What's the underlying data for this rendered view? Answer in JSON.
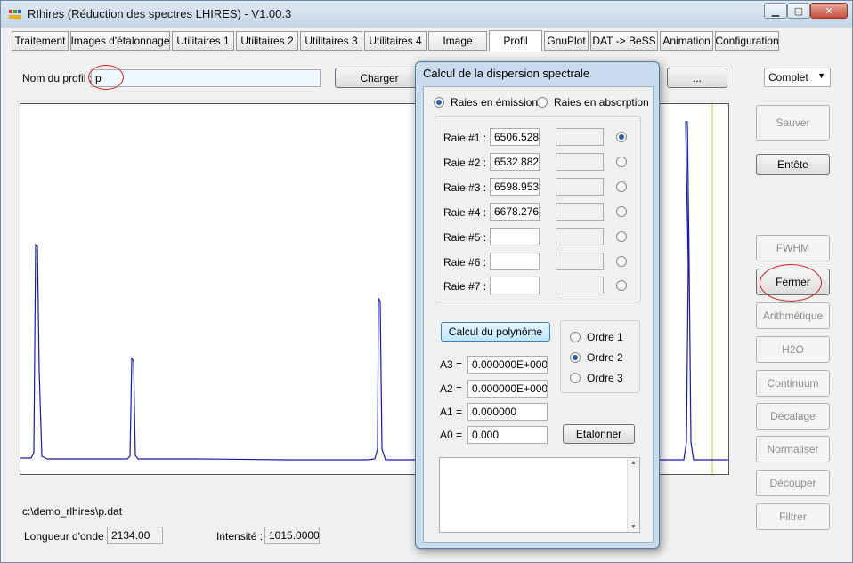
{
  "window": {
    "title": "RIhires (Réduction des spectres LHIRES) - V1.00.3"
  },
  "tabs": [
    "Traitement",
    "Images d'étalonnage",
    "Utilitaires 1",
    "Utilitaires 2",
    "Utilitaires 3",
    "Utilitaires 4",
    "Image",
    "Profil",
    "GnuPlot",
    "DAT -> BeSS",
    "Animation",
    "Configuration"
  ],
  "active_tab": "Profil",
  "profile": {
    "name_label": "Nom du profil :",
    "name_value": "p",
    "load_button": "Charger",
    "browse_button": "...",
    "mode_select": "Complet",
    "file_path": "c:\\demo_rlhires\\p.dat",
    "wavelength_label": "Longueur d'onde :",
    "wavelength_value": "2134.00",
    "intensity_label": "Intensité :",
    "intensity_value": "1015.0000"
  },
  "side_buttons": {
    "save": "Sauver",
    "header": "Entête",
    "fwhm": "FWHM",
    "close": "Fermer",
    "arith": "Arithmétique",
    "h2o": "H2O",
    "continuum": "Continuum",
    "shift": "Décalage",
    "normalize": "Normaliser",
    "cut": "Découper",
    "filter": "Filtrer"
  },
  "dialog": {
    "title": "Calcul de la dispersion spectrale",
    "emission_label": "Raies en émission",
    "absorption_label": "Raies en absorption",
    "lines": [
      {
        "label": "Raie #1 :",
        "value": "6506.528"
      },
      {
        "label": "Raie #2 :",
        "value": "6532.882"
      },
      {
        "label": "Raie #3 :",
        "value": "6598.953"
      },
      {
        "label": "Raie #4 :",
        "value": "6678.276"
      },
      {
        "label": "Raie #5 :",
        "value": ""
      },
      {
        "label": "Raie #6 :",
        "value": ""
      },
      {
        "label": "Raie #7 :",
        "value": ""
      }
    ],
    "poly_button": "Calcul du polynôme",
    "orders": [
      "Ordre 1",
      "Ordre 2",
      "Ordre 3"
    ],
    "coeffs": [
      {
        "label": "A3 =",
        "value": "0.000000E+000"
      },
      {
        "label": "A2 =",
        "value": "0.000000E+000"
      },
      {
        "label": "A1 =",
        "value": "0.000000"
      },
      {
        "label": "A0 =",
        "value": "0.000"
      }
    ],
    "calibrate_button": "Etalonner"
  },
  "colors": {
    "spectrum": "#1a1aa8",
    "cursor": "#d8c020",
    "annotation": "#d32020"
  }
}
